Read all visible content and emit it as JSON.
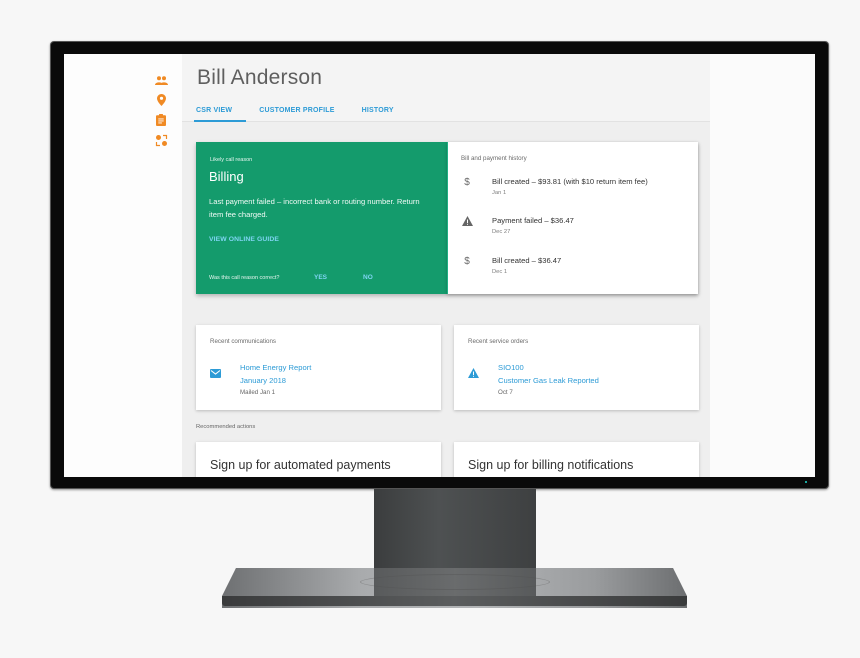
{
  "rail": {
    "icons": [
      "people-icon",
      "location-pin-icon",
      "clipboard-icon",
      "workflow-icon"
    ],
    "accent": "#f08a24"
  },
  "header": {
    "title": "Bill Anderson",
    "tabs": [
      {
        "label": "CSR VIEW",
        "active": true
      },
      {
        "label": "CUSTOMER PROFILE",
        "active": false
      },
      {
        "label": "HISTORY",
        "active": false
      }
    ]
  },
  "call_reason": {
    "eyebrow": "Likely call reason",
    "title": "Billing",
    "description": "Last payment failed – incorrect bank or routing number. Return item fee charged.",
    "guide_link": "VIEW ONLINE GUIDE",
    "question": "Was this call reason correct?",
    "yes_label": "YES",
    "no_label": "NO",
    "color": "#149b6c"
  },
  "billing_history": {
    "label": "Bill and payment history",
    "items": [
      {
        "icon": "dollar-icon",
        "title": "Bill created – $93.81 (with $10 return item fee)",
        "date": "Jan 1"
      },
      {
        "icon": "warning-icon",
        "title": "Payment failed – $36.47",
        "date": "Dec 27"
      },
      {
        "icon": "dollar-icon",
        "title": "Bill created – $36.47",
        "date": "Dec 1"
      }
    ]
  },
  "communications": {
    "label": "Recent communications",
    "icon": "mail-icon",
    "line1": "Home Energy Report",
    "line2": "January 2018",
    "line3": "Mailed Jan 1"
  },
  "service_orders": {
    "label": "Recent service orders",
    "icon": "alert-icon",
    "line1": "SIO100",
    "line2": "Customer Gas Leak Reported",
    "line3": "Oct 7"
  },
  "recommended": {
    "label": "Recommended actions",
    "actions": [
      {
        "title": "Sign up for automated payments"
      },
      {
        "title": "Sign up for billing notifications"
      }
    ]
  },
  "link_color": "#2d9bd6"
}
